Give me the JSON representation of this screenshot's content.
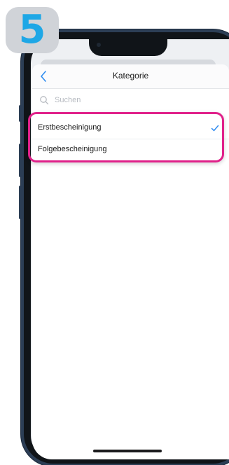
{
  "step": {
    "number": "5"
  },
  "navbar": {
    "title": "Kategorie",
    "back_icon": "chevron-left-icon"
  },
  "search": {
    "placeholder": "Suchen",
    "value": "",
    "icon": "search-icon"
  },
  "list": {
    "items": [
      {
        "label": "Erstbescheinigung",
        "selected": true
      },
      {
        "label": "Folgebescheinigung",
        "selected": false
      }
    ]
  },
  "colors": {
    "accent": "#1ea7e6",
    "highlight": "#e0218a",
    "ios_blue": "#2f8cf0",
    "frame": "#2c3e55"
  }
}
